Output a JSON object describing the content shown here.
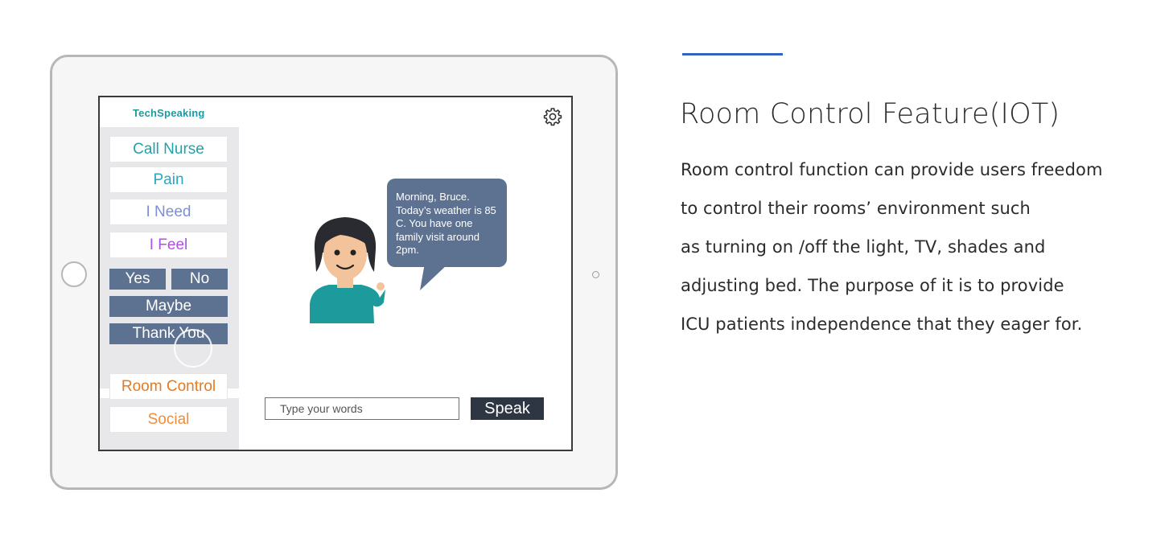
{
  "app": {
    "brand": "TechSpeaking",
    "settings_icon": "gear-icon"
  },
  "sidebar": {
    "phrases": [
      {
        "label": "Call Nurse",
        "color": "#1fa3aa"
      },
      {
        "label": "Pain",
        "color": "#2aa6c2"
      },
      {
        "label": "I Need",
        "color": "#7c8fd6"
      },
      {
        "label": "I Feel",
        "color": "#b24ee0"
      }
    ],
    "responses": [
      "Yes",
      "No",
      "Maybe",
      "Thank You"
    ],
    "response_color": "#5d7191",
    "features": [
      {
        "label": "Room Control",
        "color": "#e67a22"
      },
      {
        "label": "Social",
        "color": "#ef8d3b"
      }
    ]
  },
  "assistant": {
    "message": "Morning, Bruce.\nToday’s weather is 85 C. You have one family visit around 2pm."
  },
  "composer": {
    "placeholder": "Type your words",
    "speak_label": "Speak"
  },
  "article": {
    "title": "Room Control Feature(IOT)",
    "lines": [
      "Room control function can provide users freedom",
      "to control their rooms’ environment such",
      "as turning on  /off the light, TV, shades and",
      "adjusting bed. The purpose of it is to provide",
      "ICU patients independence that they eager for."
    ],
    "accent_color": "#2f63c4"
  }
}
